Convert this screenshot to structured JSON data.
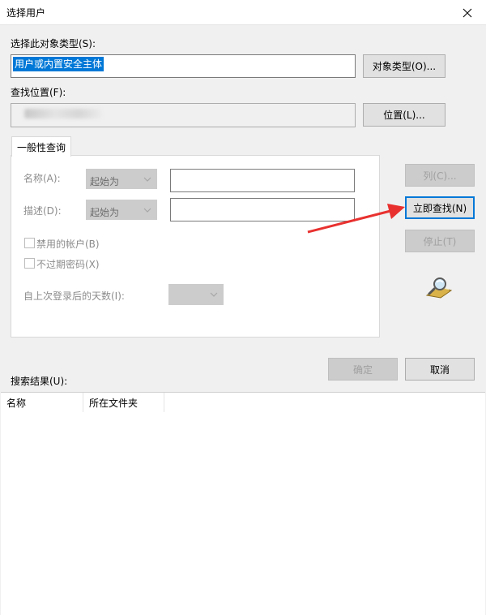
{
  "window": {
    "title": "选择用户"
  },
  "object_type": {
    "label": "选择此对象类型(S):",
    "value": "用户或内置安全主体",
    "button": "对象类型(O)..."
  },
  "location": {
    "label": "查找位置(F):",
    "button": "位置(L)..."
  },
  "tab": {
    "label": "一般性查询"
  },
  "query": {
    "name_label": "名称(A):",
    "name_mode": "起始为",
    "desc_label": "描述(D):",
    "desc_mode": "起始为",
    "disabled_accounts": "禁用的帐户(B)",
    "non_expiring": "不过期密码(X)",
    "days_label": "自上次登录后的天数(I):"
  },
  "side_buttons": {
    "columns": "列(C)...",
    "find_now": "立即查找(N)",
    "stop": "停止(T)"
  },
  "dialog_buttons": {
    "ok": "确定",
    "cancel": "取消"
  },
  "results": {
    "label": "搜索结果(U):",
    "columns": [
      "名称",
      "所在文件夹"
    ]
  },
  "colors": {
    "accent": "#0078d7",
    "annotation_arrow": "#e8312f"
  },
  "icons": [
    "close-icon",
    "chevron-down-icon",
    "search-magnifier-icon"
  ]
}
